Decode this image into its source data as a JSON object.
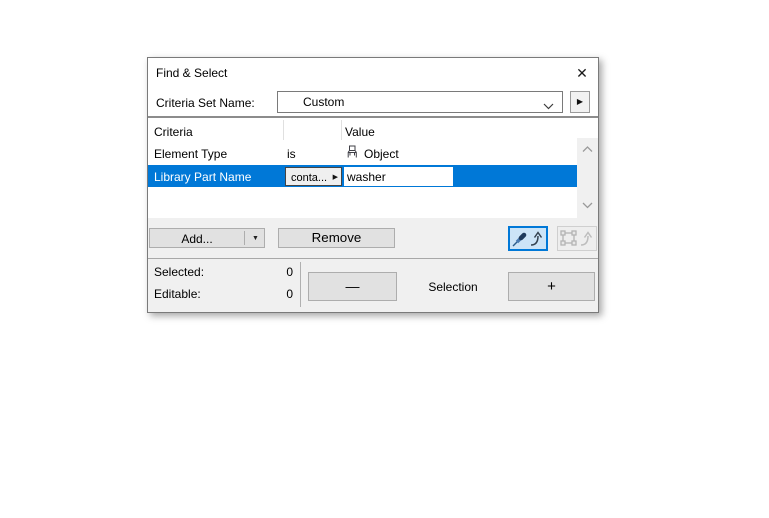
{
  "window": {
    "title": "Find & Select"
  },
  "icons": {
    "close": "✕",
    "flyout_right": "▶",
    "operator_more": "▶",
    "add_dropdown": "▼"
  },
  "criteria_set": {
    "label": "Criteria Set Name:",
    "value": "Custom"
  },
  "table": {
    "col_criteria": "Criteria",
    "col_value": "Value",
    "rows": [
      {
        "criteria": "Element Type",
        "operator": "is",
        "value": "Object",
        "icon": "object-chair-icon",
        "selected": false
      },
      {
        "criteria": "Library Part Name",
        "operator": "conta...",
        "value": "washer",
        "selected": true
      }
    ]
  },
  "actions": {
    "add": "Add...",
    "remove": "Remove"
  },
  "footer": {
    "selected_label": "Selected:",
    "selected_count": "0",
    "editable_label": "Editable:",
    "editable_count": "0",
    "minus": "—",
    "selection_label": "Selection",
    "plus": "+"
  },
  "colors": {
    "selection_highlight": "#0078d7",
    "active_tool_border": "#0078d7",
    "active_tool_bg": "#cce4f7",
    "button_bg": "#e1e1e1",
    "dialog_bg": "#f0f0f0"
  }
}
